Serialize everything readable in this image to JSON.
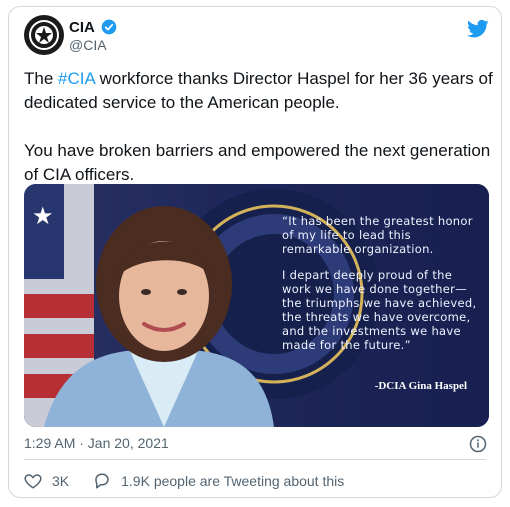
{
  "tweet": {
    "author_name": "CIA",
    "handle": "@CIA",
    "hashtag": "#CIA",
    "text_prefix": "The ",
    "text_suffix": " workforce thanks Director Haspel for her 36 years of dedicated service to the American people.",
    "text_second": "You have broken barriers and empowered the next generation of CIA officers.",
    "timestamp": "1:29 AM · Jan 20, 2021",
    "like_count": "3K",
    "tweeting_about": "1.9K people are Tweeting about this"
  },
  "media": {
    "quote_1": "“It has been the greatest honor of my life to lead this remarkable organization.",
    "quote_2": "I depart deeply proud of the work we have done together—the triumphs we have achieved, the threats we have overcome, and the investments we have made for the future.”",
    "signature": "-DCIA Gina Haspel"
  },
  "colors": {
    "accent": "#1d9bf0",
    "text": "#0f1419",
    "secondary": "#536471",
    "media_background": "#1b2656"
  },
  "icons": [
    "verified-icon",
    "twitter-bird-icon",
    "info-icon",
    "heart-icon",
    "reply-icon"
  ]
}
